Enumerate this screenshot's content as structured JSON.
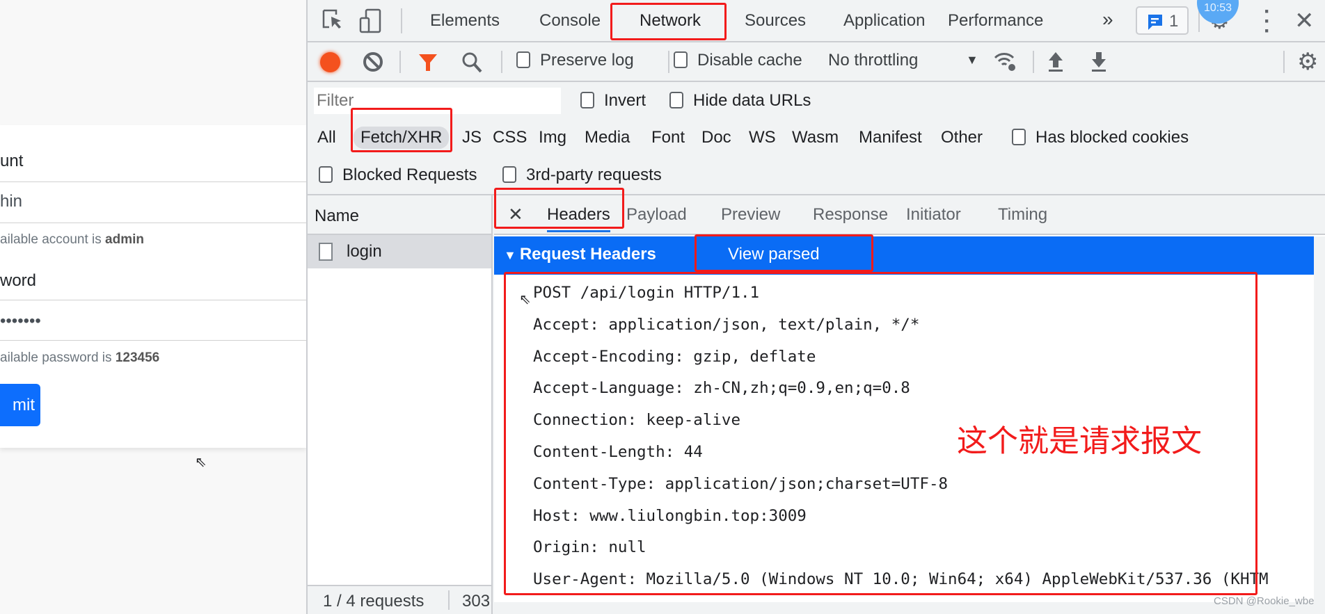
{
  "page": {
    "account_label": "unt",
    "account_value": "hin",
    "account_hint_prefix": "ailable account is ",
    "account_hint_value": "admin",
    "password_label": "word",
    "password_value": "•••••••",
    "password_hint_prefix": "ailable password is ",
    "password_hint_value": "123456",
    "submit_label": "mit"
  },
  "devtools": {
    "tabs": [
      "Elements",
      "Console",
      "Network",
      "Sources",
      "Application",
      "Performance"
    ],
    "active_tab": "Network",
    "more_tabs": "»",
    "issues_count": "1",
    "clock_overlay": "10:53",
    "toolbar": {
      "preserve_log": "Preserve log",
      "disable_cache": "Disable cache",
      "throttling": "No throttling"
    },
    "filter": {
      "placeholder": "Filter",
      "invert": "Invert",
      "hide_data_urls": "Hide data URLs"
    },
    "types": [
      "All",
      "Fetch/XHR",
      "JS",
      "CSS",
      "Img",
      "Media",
      "Font",
      "Doc",
      "WS",
      "Wasm",
      "Manifest",
      "Other"
    ],
    "active_type": "Fetch/XHR",
    "has_blocked_cookies": "Has blocked cookies",
    "blocked_requests": "Blocked Requests",
    "third_party": "3rd-party requests",
    "name_header": "Name",
    "requests": [
      "login"
    ],
    "footer": {
      "requests": "1 / 4 requests",
      "size": "303"
    },
    "detail_tabs": [
      "Headers",
      "Payload",
      "Preview",
      "Response",
      "Initiator",
      "Timing"
    ],
    "active_detail_tab": "Headers",
    "section_title": "Request Headers",
    "view_parsed": "View parsed",
    "raw_headers": [
      "POST /api/login HTTP/1.1",
      "Accept: application/json, text/plain, */*",
      "Accept-Encoding: gzip, deflate",
      "Accept-Language: zh-CN,zh;q=0.9,en;q=0.8",
      "Connection: keep-alive",
      "Content-Length: 44",
      "Content-Type: application/json;charset=UTF-8",
      "Host: www.liulongbin.top:3009",
      "Origin: null",
      "User-Agent: Mozilla/5.0 (Windows NT 10.0; Win64; x64) AppleWebKit/537.36 (KHTM"
    ]
  },
  "annotation": "这个就是请求报文",
  "watermark": "CSDN @Rookie_wbe",
  "colors": {
    "accent": "#1a73e8",
    "selection_bar": "#0a6cf5",
    "record": "#f4511e",
    "annotation": "#f21b1b"
  }
}
